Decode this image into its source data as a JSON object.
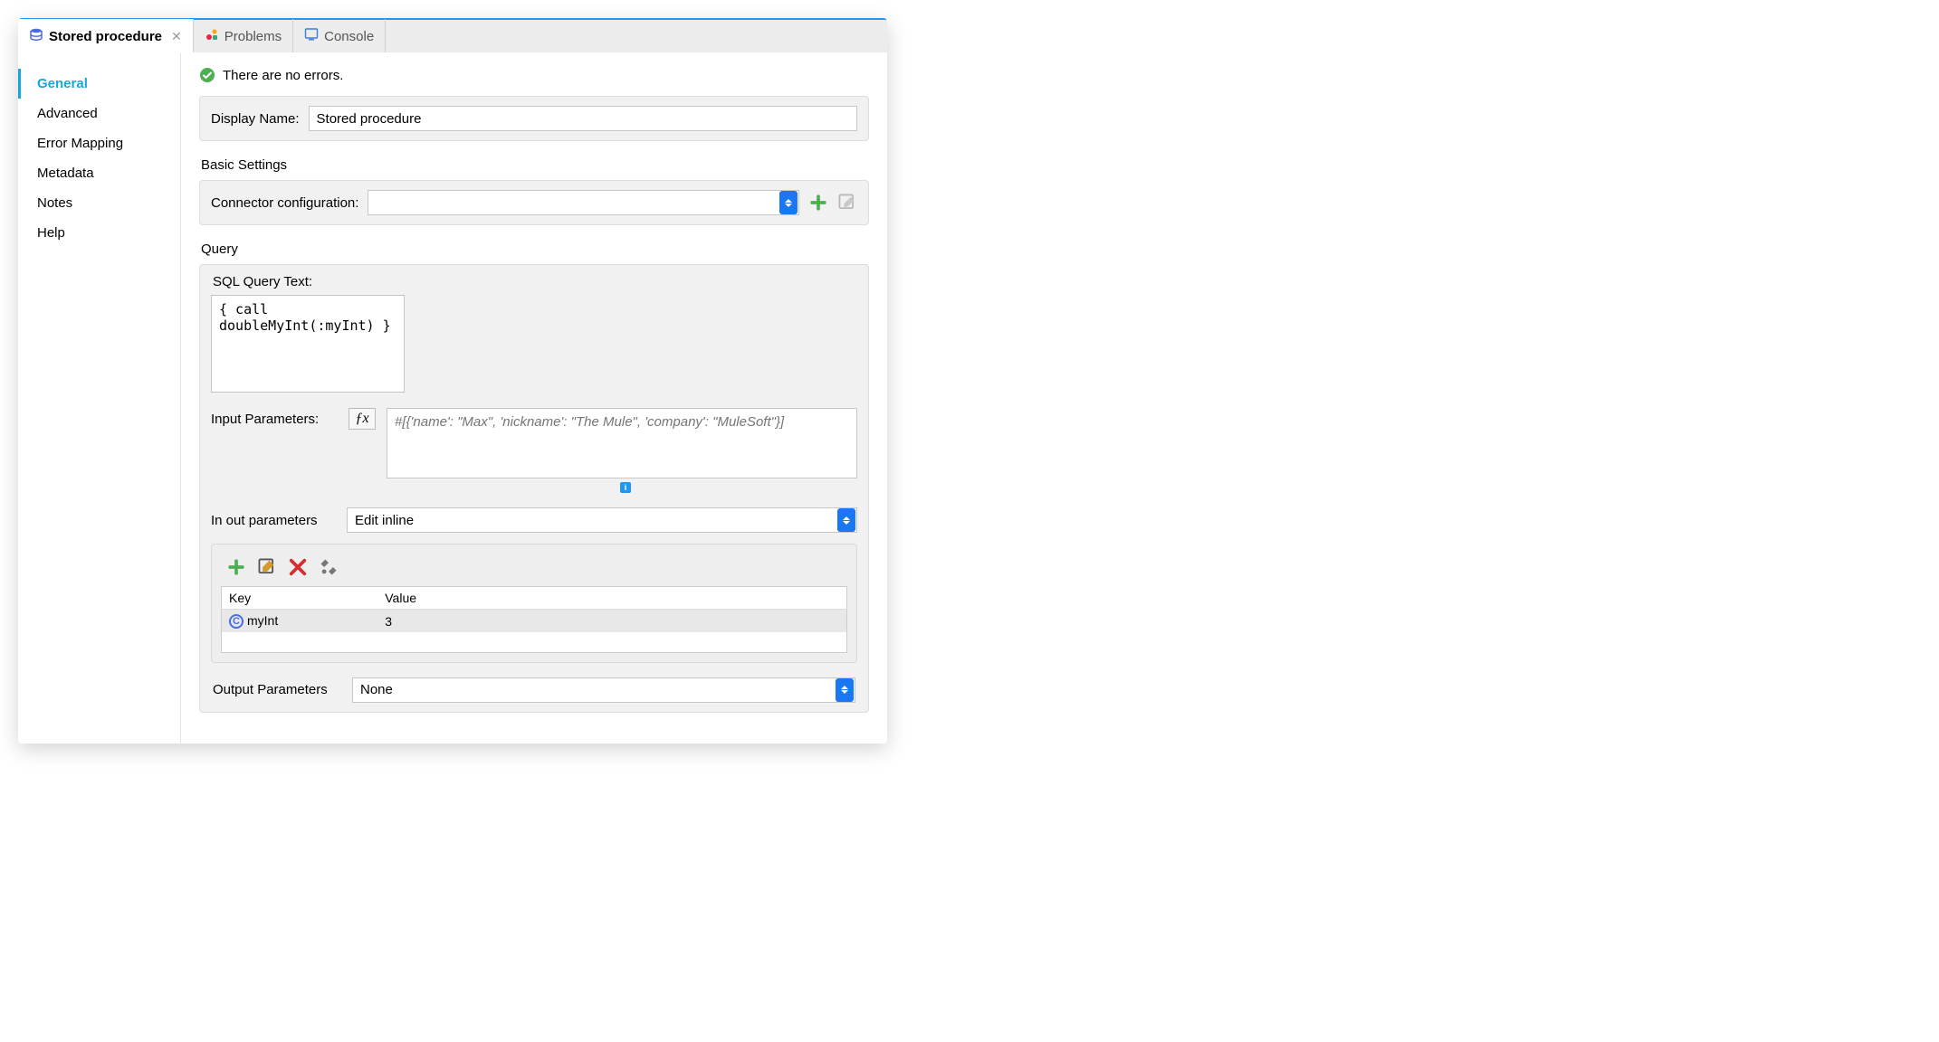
{
  "tabs": [
    {
      "label": "Stored procedure",
      "active": true,
      "closable": true
    },
    {
      "label": "Problems",
      "active": false,
      "closable": false
    },
    {
      "label": "Console",
      "active": false,
      "closable": false
    }
  ],
  "sidebar": {
    "items": [
      {
        "label": "General",
        "active": true
      },
      {
        "label": "Advanced",
        "active": false
      },
      {
        "label": "Error Mapping",
        "active": false
      },
      {
        "label": "Metadata",
        "active": false
      },
      {
        "label": "Notes",
        "active": false
      },
      {
        "label": "Help",
        "active": false
      }
    ]
  },
  "status": {
    "message": "There are no errors."
  },
  "displayName": {
    "label": "Display Name:",
    "value": "Stored procedure"
  },
  "basicSettings": {
    "title": "Basic Settings",
    "connectorConfig": {
      "label": "Connector configuration:",
      "value": ""
    }
  },
  "query": {
    "title": "Query",
    "sqlLabel": "SQL Query Text:",
    "sqlValue": "{ call doubleMyInt(:myInt) }",
    "inputParamsLabel": "Input Parameters:",
    "inputParamsPlaceholder": "#[{'name': \"Max\", 'nickname': \"The Mule\", 'company': \"MuleSoft\"}]",
    "inOutLabel": "In out parameters",
    "inOutValue": "Edit inline",
    "table": {
      "headers": [
        "Key",
        "Value"
      ],
      "rows": [
        {
          "key": "myInt",
          "value": "3"
        }
      ]
    },
    "outputLabel": "Output Parameters",
    "outputValue": "None"
  }
}
